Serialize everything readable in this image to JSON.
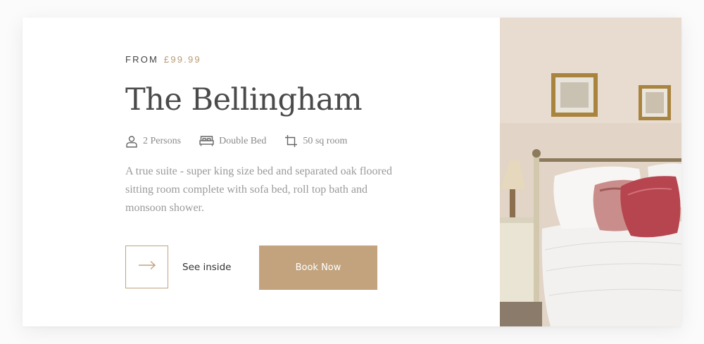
{
  "room": {
    "price_prefix": "FROM",
    "price": "£99.99",
    "name": "The Bellingham",
    "features": [
      {
        "icon": "person-icon",
        "label": "2 Persons"
      },
      {
        "icon": "bed-icon",
        "label": "Double Bed"
      },
      {
        "icon": "crop-icon",
        "label": "50 sq room"
      }
    ],
    "description": "A true suite - super king size bed and separated oak floored sitting room complete with sofa bed, roll top bath and monsoon shower."
  },
  "actions": {
    "see_inside_label": "See inside",
    "book_label": "Book Now"
  },
  "colors": {
    "accent": "#c2a37e",
    "title": "#4a4a4a",
    "muted_text": "#9a9a9a"
  },
  "image": {
    "alt": "Bedroom photo with double bed and framed pictures"
  }
}
